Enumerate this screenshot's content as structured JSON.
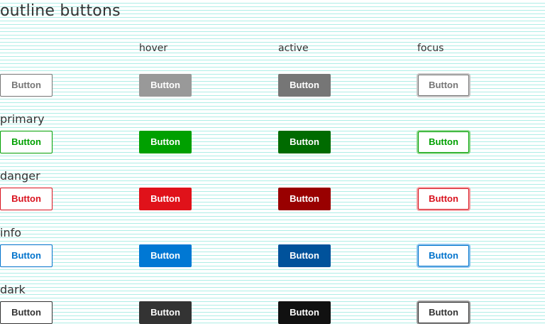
{
  "page": {
    "title": "outline buttons"
  },
  "columns": {
    "hover": "hover",
    "active": "active",
    "focus": "focus"
  },
  "rows": [
    {
      "key": "default",
      "label": "",
      "button_label": "Button",
      "colors": {
        "normal_border": "#767676",
        "normal_text": "#767676",
        "hover_bg": "#999999",
        "active_bg": "#767676",
        "focus_ring": "#c8c8c8"
      }
    },
    {
      "key": "primary",
      "label": "primary",
      "button_label": "Button",
      "colors": {
        "normal_border": "#00a000",
        "normal_text": "#00a000",
        "hover_bg": "#00a000",
        "active_bg": "#006b00",
        "focus_ring": "#8fd88f"
      }
    },
    {
      "key": "danger",
      "label": "danger",
      "button_label": "Button",
      "colors": {
        "normal_border": "#d9131f",
        "normal_text": "#d9131f",
        "hover_bg": "#e0121a",
        "active_bg": "#990000",
        "focus_ring": "#f2a3a6"
      }
    },
    {
      "key": "info",
      "label": "info",
      "button_label": "Button",
      "colors": {
        "normal_border": "#0073cc",
        "normal_text": "#0073cc",
        "hover_bg": "#0078d4",
        "active_bg": "#00529b",
        "focus_ring": "#8cc4ee"
      }
    },
    {
      "key": "dark",
      "label": "dark",
      "button_label": "Button",
      "colors": {
        "normal_border": "#333333",
        "normal_text": "#333333",
        "hover_bg": "#333333",
        "active_bg": "#111111",
        "focus_ring": "#9a9a9a"
      }
    }
  ]
}
